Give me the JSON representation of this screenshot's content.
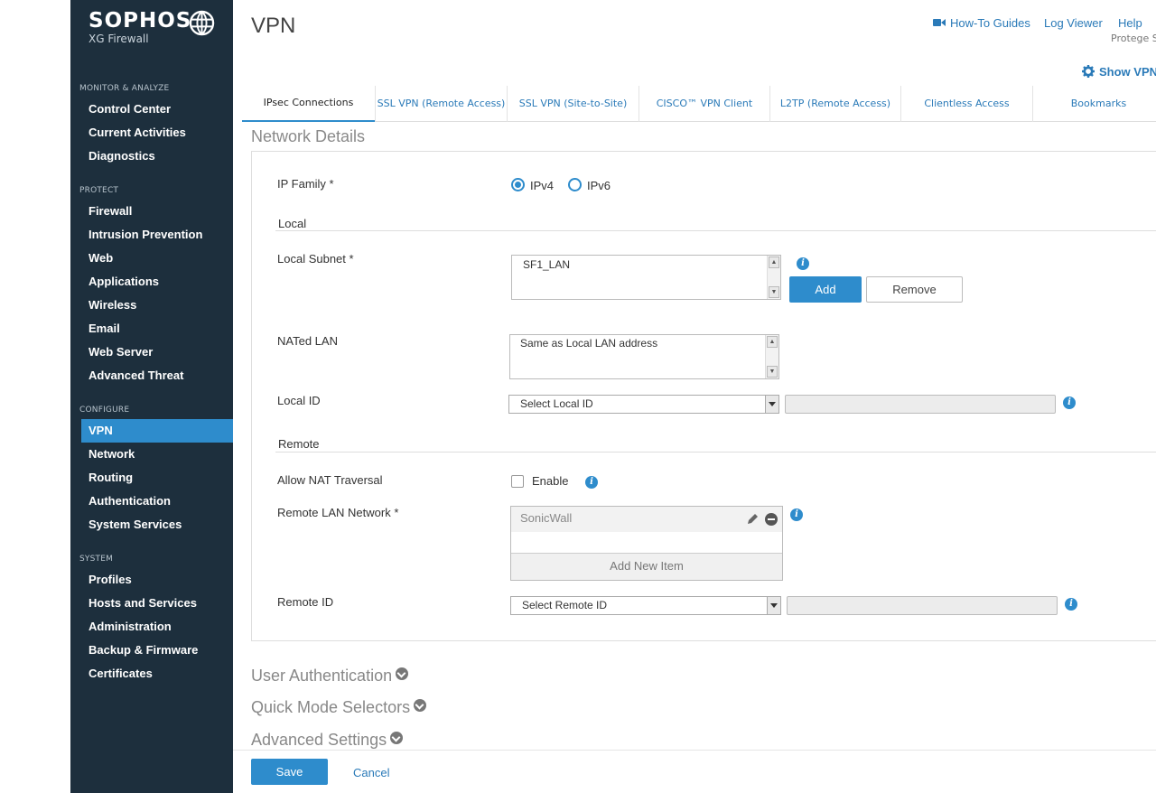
{
  "brand": {
    "name": "SOPHOS",
    "product": "XG Firewall"
  },
  "nav": {
    "sections": [
      {
        "title": "MONITOR & ANALYZE",
        "items": [
          "Control Center",
          "Current Activities",
          "Diagnostics"
        ]
      },
      {
        "title": "PROTECT",
        "items": [
          "Firewall",
          "Intrusion Prevention",
          "Web",
          "Applications",
          "Wireless",
          "Email",
          "Web Server",
          "Advanced Threat"
        ]
      },
      {
        "title": "CONFIGURE",
        "items": [
          "VPN",
          "Network",
          "Routing",
          "Authentication",
          "System Services"
        ]
      },
      {
        "title": "SYSTEM",
        "items": [
          "Profiles",
          "Hosts and Services",
          "Administration",
          "Backup & Firmware",
          "Certificates"
        ]
      }
    ],
    "active": "VPN"
  },
  "header": {
    "title": "VPN",
    "links": {
      "howto": "How-To Guides",
      "logviewer": "Log Viewer",
      "help": "Help"
    },
    "user": "Protege S",
    "show_vpn": "Show VPN"
  },
  "tabs": [
    "IPsec Connections",
    "SSL VPN (Remote Access)",
    "SSL VPN (Site-to-Site)",
    "CISCO™ VPN Client",
    "L2TP (Remote Access)",
    "Clientless Access",
    "Bookmarks"
  ],
  "network": {
    "section_title": "Network Details",
    "ip_family_label": "IP Family *",
    "ipv4": "IPv4",
    "ipv6": "IPv6",
    "ip_family_value": "IPv4",
    "local_heading": "Local",
    "local_subnet_label": "Local Subnet *",
    "local_subnet_items": [
      "SF1_LAN"
    ],
    "add_btn": "Add",
    "remove_btn": "Remove",
    "nated_lan_label": "NATed LAN",
    "nated_lan_value": "Same as Local LAN address",
    "local_id_label": "Local ID",
    "local_id_select": "Select Local ID",
    "remote_heading": "Remote",
    "nat_traversal_label": "Allow NAT Traversal",
    "nat_traversal_enable": "Enable",
    "nat_traversal_checked": false,
    "remote_lan_label": "Remote LAN Network *",
    "remote_lan_items": [
      "SonicWall"
    ],
    "add_new_item": "Add New Item",
    "remote_id_label": "Remote ID",
    "remote_id_select": "Select Remote ID"
  },
  "collapsed_sections": [
    "User Authentication",
    "Quick Mode Selectors",
    "Advanced Settings"
  ],
  "footer": {
    "save": "Save",
    "cancel": "Cancel"
  },
  "colors": {
    "sidebar": "#1d2f3d",
    "accent": "#2e8ccc",
    "link": "#2a7ab8"
  }
}
